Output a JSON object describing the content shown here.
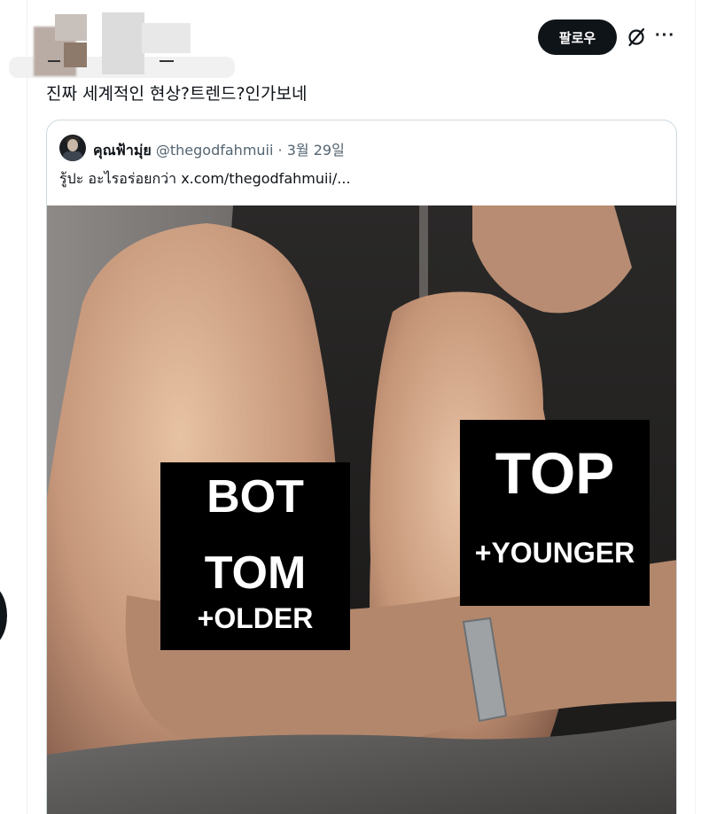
{
  "post": {
    "follow_label": "팔로우",
    "more_label": "···",
    "text": "진짜 세계적인 현상?트렌드?인가보네"
  },
  "icons": {
    "grok": "grok-slash-icon",
    "more": "more-horizontal-icon",
    "avatar": "quoted-user-avatar"
  },
  "quote": {
    "name": "คุณฟ้ามุ่ย",
    "handle": "@thegodfahmuii",
    "separator": "·",
    "date": "3월 29일",
    "body": "รู้ปะ อะไรอร่อยกว่า  x.com/thegodfahmuii/..."
  },
  "media": {
    "bot_line1": "BOT",
    "bot_line2": "TOM",
    "bot_line3": "+OLDER",
    "top_line1": "TOP",
    "top_line2": "+YOUNGER"
  },
  "colors": {
    "text_primary": "#0f1419",
    "text_secondary": "#536471",
    "border": "#cfd9de",
    "follow_bg": "#0f1419"
  }
}
